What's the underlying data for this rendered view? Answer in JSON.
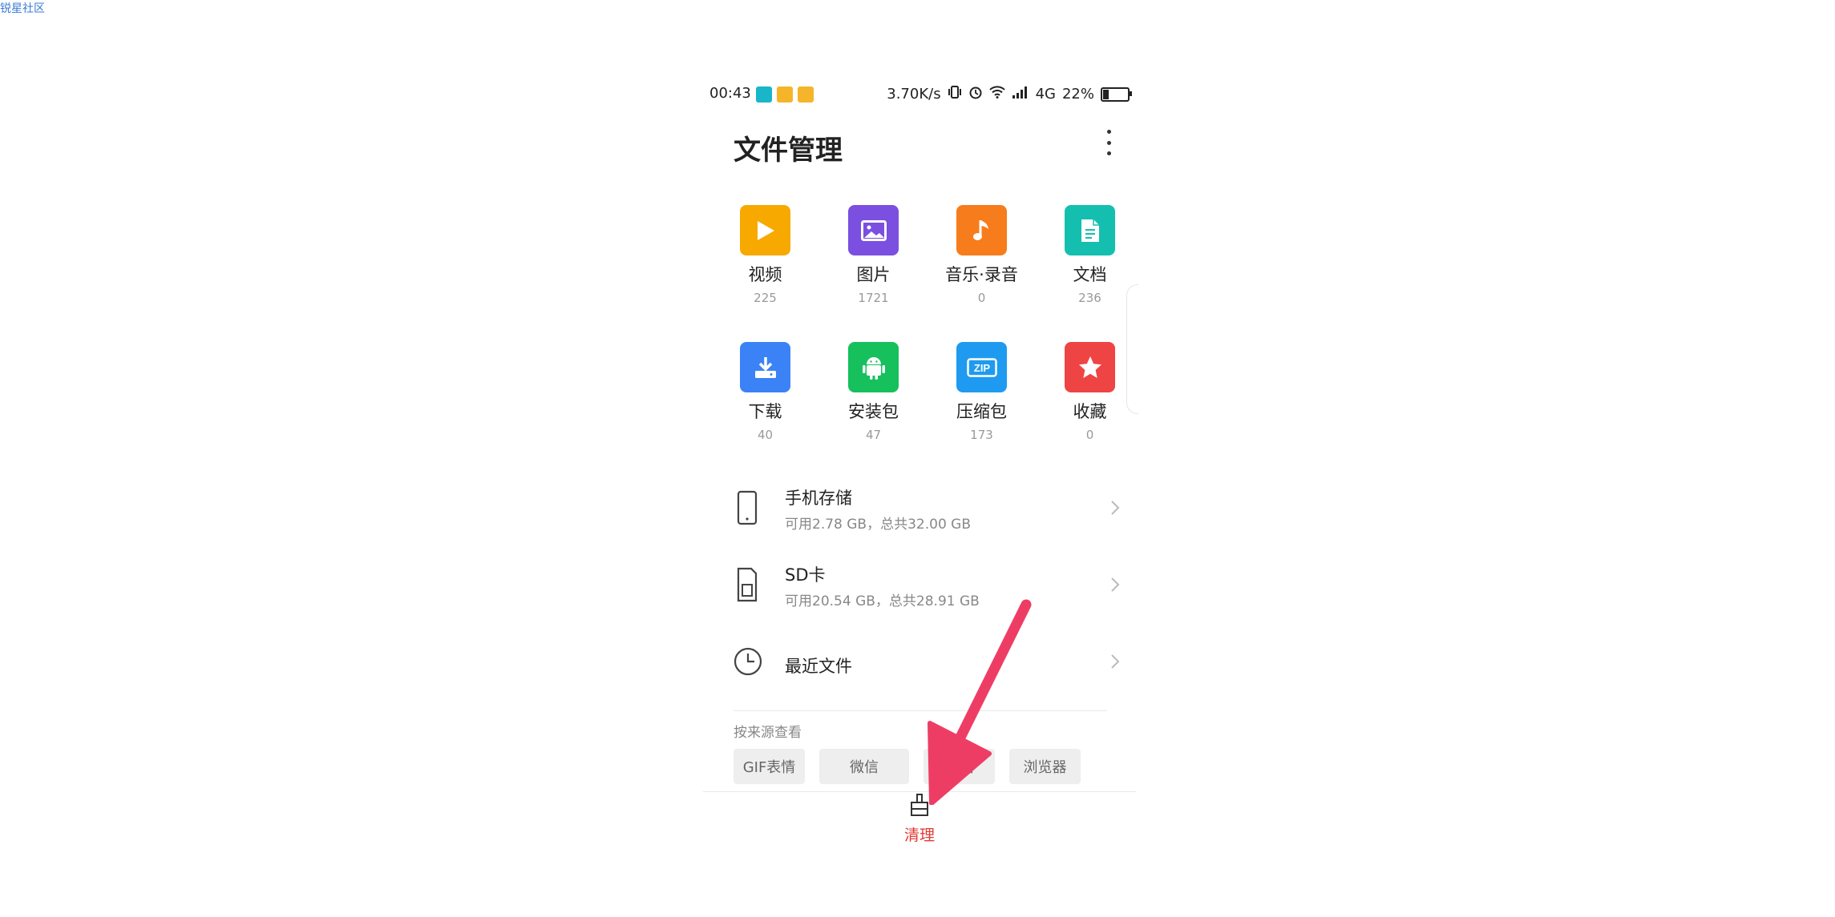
{
  "watermark": "锐星社区",
  "status_bar": {
    "time": "00:43",
    "net_speed": "3.70K/s",
    "network": "4G",
    "battery": "22%",
    "battery_level": 0.22
  },
  "header": {
    "title": "文件管理"
  },
  "categories": [
    {
      "name": "视频",
      "count": "225",
      "color": "#F7A900",
      "icon": "play-icon"
    },
    {
      "name": "图片",
      "count": "1721",
      "color": "#7B4FE0",
      "icon": "image-icon"
    },
    {
      "name": "音乐·录音",
      "count": "0",
      "color": "#F77C1B",
      "icon": "music-note-icon"
    },
    {
      "name": "文档",
      "count": "236",
      "color": "#14BFB0",
      "icon": "document-icon"
    },
    {
      "name": "下载",
      "count": "40",
      "color": "#3B82F6",
      "icon": "download-icon"
    },
    {
      "name": "安装包",
      "count": "47",
      "color": "#16C05D",
      "icon": "android-icon"
    },
    {
      "name": "压缩包",
      "count": "173",
      "color": "#1E9BF0",
      "icon": "zip-icon",
      "badge": "ZIP"
    },
    {
      "name": "收藏",
      "count": "0",
      "color": "#EF4444",
      "icon": "star-icon"
    }
  ],
  "storage": [
    {
      "label": "手机存储",
      "sub": "可用2.78 GB，总共32.00 GB",
      "icon": "phone-icon"
    },
    {
      "label": "SD卡",
      "sub": "可用20.54 GB，总共28.91 GB",
      "icon": "sd-card-icon"
    },
    {
      "label": "最近文件",
      "icon": "clock-icon"
    }
  ],
  "sources": {
    "title": "按来源查看",
    "chips": [
      "GIF表情",
      "微信",
      "截图",
      "浏览器"
    ]
  },
  "bottom": {
    "clean_label": "清理"
  },
  "colors": {
    "accent_red": "#e53935",
    "annotation_arrow": "#EE3D64"
  }
}
